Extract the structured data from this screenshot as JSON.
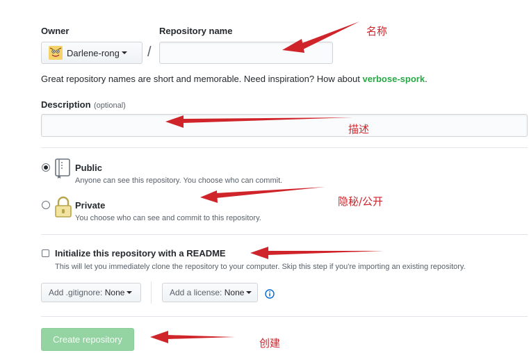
{
  "owner": {
    "label": "Owner",
    "selected": "Darlene-rong"
  },
  "repo_name": {
    "label": "Repository name",
    "value": "",
    "separator": "/"
  },
  "hint": {
    "prefix": "Great repository names are short and memorable. Need inspiration? How about ",
    "suggestion": "verbose-spork",
    "suffix": "."
  },
  "description": {
    "label": "Description",
    "optional": "(optional)",
    "value": ""
  },
  "visibility": {
    "public": {
      "label": "Public",
      "note": "Anyone can see this repository. You choose who can commit.",
      "checked": true
    },
    "private": {
      "label": "Private",
      "note": "You choose who can see and commit to this repository.",
      "checked": false
    }
  },
  "readme": {
    "label": "Initialize this repository with a README",
    "note": "This will let you immediately clone the repository to your computer. Skip this step if you're importing an existing repository.",
    "checked": false
  },
  "gitignore": {
    "prefix": "Add .gitignore:",
    "value": "None"
  },
  "license": {
    "prefix": "Add a license:",
    "value": "None"
  },
  "create_button": {
    "label": "Create repository",
    "color": "#94d3a2"
  },
  "annotations": {
    "name": "名称",
    "description": "描述",
    "visibility": "隐秘/公开",
    "create": "创建",
    "color": "#d0242b"
  },
  "icons": {
    "owner_avatar": "avatar-icon",
    "public": "repo-book-icon",
    "private": "lock-icon",
    "info": "info-icon"
  },
  "colors": {
    "suggestion": "#28a745",
    "border": "#d1d5da"
  }
}
